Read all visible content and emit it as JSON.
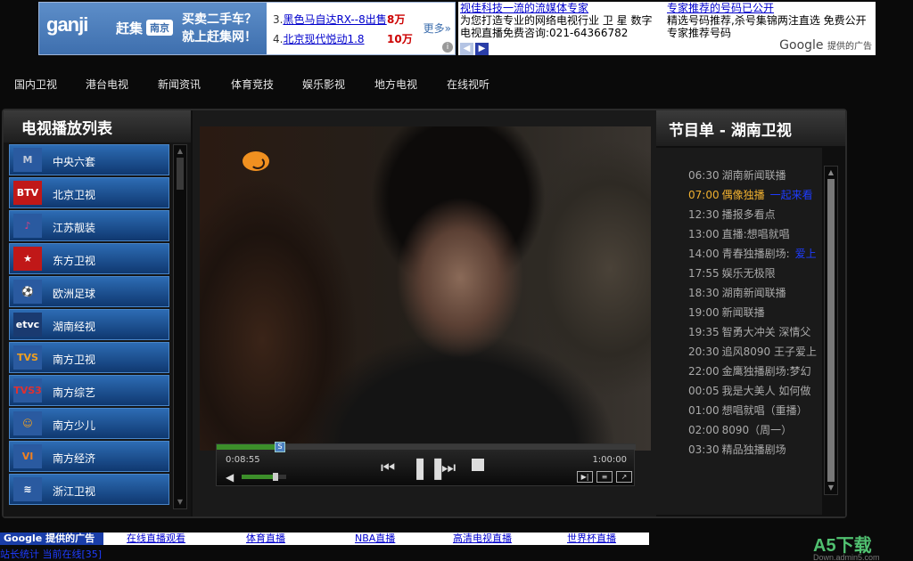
{
  "ad_left": {
    "logo": "ganji",
    "logo_cn": "赶集",
    "city": "南京",
    "slogan_1": "买卖二手车？",
    "slogan_2": "就上赶集网！",
    "rows": [
      {
        "num": "3.",
        "text": "黑色马自达RX--8出售",
        "price": "8万"
      },
      {
        "num": "4.",
        "text": "北京现代悦动1.8",
        "price": "10万"
      }
    ],
    "more": "更多»",
    "info": "i"
  },
  "ad_right": {
    "col1_title": "视佳科技一流的流媒体专家",
    "col1_line1": "为您打造专业的网络电视行业 卫 星 数字",
    "col1_line2": "电视直播免费咨询:021-64366782",
    "col2_title": "专家推荐的号码已公开",
    "col2_line1": "精选号码推荐,杀号集锦两注直选 免费公开",
    "col2_line2": "专家推荐号码",
    "prev": "◀",
    "next": "▶",
    "google": "Google",
    "google_suffix": "提供的广告"
  },
  "nav": [
    "国内卫视",
    "港台电视",
    "新闻资讯",
    "体育竞技",
    "娱乐影视",
    "地方电视",
    "在线视听"
  ],
  "left_panel": {
    "title": "电视播放列表",
    "channels": [
      {
        "name": "中央六套",
        "logo": "M",
        "logo_bg": "#2a5aa0",
        "logo_color": "#c0c8d8"
      },
      {
        "name": "北京卫视",
        "logo": "BTV",
        "logo_bg": "#c01818",
        "logo_color": "#ffffff"
      },
      {
        "name": "江苏靓装",
        "logo": "♪",
        "logo_bg": "#2a5aa0",
        "logo_color": "#e04080"
      },
      {
        "name": "东方卫视",
        "logo": "★",
        "logo_bg": "#c01818",
        "logo_color": "#ffffff"
      },
      {
        "name": "欧洲足球",
        "logo": "⚽",
        "logo_bg": "#2a5aa0",
        "logo_color": "#d02020"
      },
      {
        "name": "湖南经视",
        "logo": "etvc",
        "logo_bg": "#1a3a70",
        "logo_color": "#ffffff"
      },
      {
        "name": "南方卫视",
        "logo": "TVS",
        "logo_bg": "#2a5aa0",
        "logo_color": "#f0a020"
      },
      {
        "name": "南方综艺",
        "logo": "TVS3",
        "logo_bg": "#2a5aa0",
        "logo_color": "#e03030"
      },
      {
        "name": "南方少儿",
        "logo": "☺",
        "logo_bg": "#2a5aa0",
        "logo_color": "#f0a020"
      },
      {
        "name": "南方经济",
        "logo": "VI",
        "logo_bg": "#2a5aa0",
        "logo_color": "#f08020"
      },
      {
        "name": "浙江卫视",
        "logo": "≋",
        "logo_bg": "#2a5aa0",
        "logo_color": "#ffffff"
      }
    ]
  },
  "player": {
    "current_time": "0:08:55",
    "total_time": "1:00:00",
    "seek_label": "S",
    "progress": 0.15,
    "volume": 0.75,
    "rewind": "⏮",
    "pause": "❚❚",
    "forward": "⏭",
    "btn_1": "▶|",
    "btn_2": "≡",
    "btn_3": "↗",
    "volume_icon": "◀"
  },
  "right_panel": {
    "title": "节目单 - 湖南卫视",
    "programs": [
      {
        "time": "06:30",
        "title": "湖南新闻联播",
        "link": "",
        "now": false
      },
      {
        "time": "07:00",
        "title": "偶像独播",
        "link": "一起来看",
        "now": true
      },
      {
        "time": "12:30",
        "title": "播报多看点",
        "link": "",
        "now": false
      },
      {
        "time": "13:00",
        "title": "直播:想唱就唱",
        "link": "",
        "now": false
      },
      {
        "time": "14:00",
        "title": "青春独播剧场:",
        "link": "爱上",
        "now": false
      },
      {
        "time": "17:55",
        "title": "娱乐无极限",
        "link": "",
        "now": false
      },
      {
        "time": "18:30",
        "title": "湖南新闻联播",
        "link": "",
        "now": false
      },
      {
        "time": "19:00",
        "title": "新闻联播",
        "link": "",
        "now": false
      },
      {
        "time": "19:35",
        "title": "智勇大冲关 深情父",
        "link": "",
        "now": false
      },
      {
        "time": "20:30",
        "title": "追风8090 王子爱上",
        "link": "",
        "now": false
      },
      {
        "time": "22:00",
        "title": "金鹰独播剧场:梦幻",
        "link": "",
        "now": false
      },
      {
        "time": "00:05",
        "title": "我是大美人 如何做",
        "link": "",
        "now": false
      },
      {
        "time": "01:00",
        "title": "想唱就唱（重播）",
        "link": "",
        "now": false
      },
      {
        "time": "02:00",
        "title": "8090（周一）",
        "link": "",
        "now": false
      },
      {
        "time": "03:30",
        "title": "精品独播剧场",
        "link": "",
        "now": false
      }
    ]
  },
  "bottom": {
    "google_label": "Google 提供的广告",
    "links": [
      "在线直播观看",
      "体育直播",
      "NBA直播",
      "高清电视直播",
      "世界杯直播"
    ],
    "counter": "站长统计 当前在线[35]"
  },
  "watermark": {
    "main": "A5下载",
    "sub": "Down.admin5.com"
  },
  "colors": {
    "accent": "#2d6cb4",
    "now_playing": "#f0b030",
    "link": "#1e3cff",
    "progress": "#3c8f2a"
  }
}
